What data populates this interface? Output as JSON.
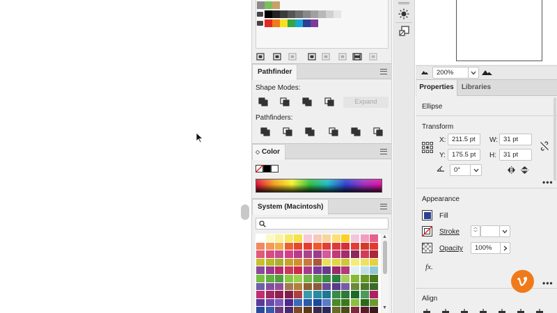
{
  "pathfinder": {
    "tab": "Pathfinder",
    "shape_modes_label": "Shape Modes:",
    "pathfinders_label": "Pathfinders:",
    "expand_label": "Expand"
  },
  "color_panel": {
    "tab": "Color"
  },
  "swatches_panel": {
    "tab": "System (Macintosh)"
  },
  "zoom": {
    "value": "200%"
  },
  "properties": {
    "tab_properties": "Properties",
    "tab_libraries": "Libraries",
    "object_type": "Ellipse",
    "transform": {
      "title": "Transform",
      "x_label": "X:",
      "x_value": "211.5 pt",
      "y_label": "Y:",
      "y_value": "175.5 pt",
      "w_label": "W:",
      "w_value": "31 pt",
      "h_label": "H:",
      "h_value": "31 pt",
      "rotate_value": "0°"
    },
    "appearance": {
      "title": "Appearance",
      "fill_label": "Fill",
      "stroke_label": "Stroke",
      "opacity_label": "Opacity",
      "opacity_value": "100%",
      "fx_label": "fx.",
      "fill_color": "#2b3f96"
    },
    "align": {
      "title": "Align"
    }
  },
  "more_label": "•••",
  "colors": {
    "panel_bg": "#efefef",
    "accent_logo": "#f07a1a"
  }
}
